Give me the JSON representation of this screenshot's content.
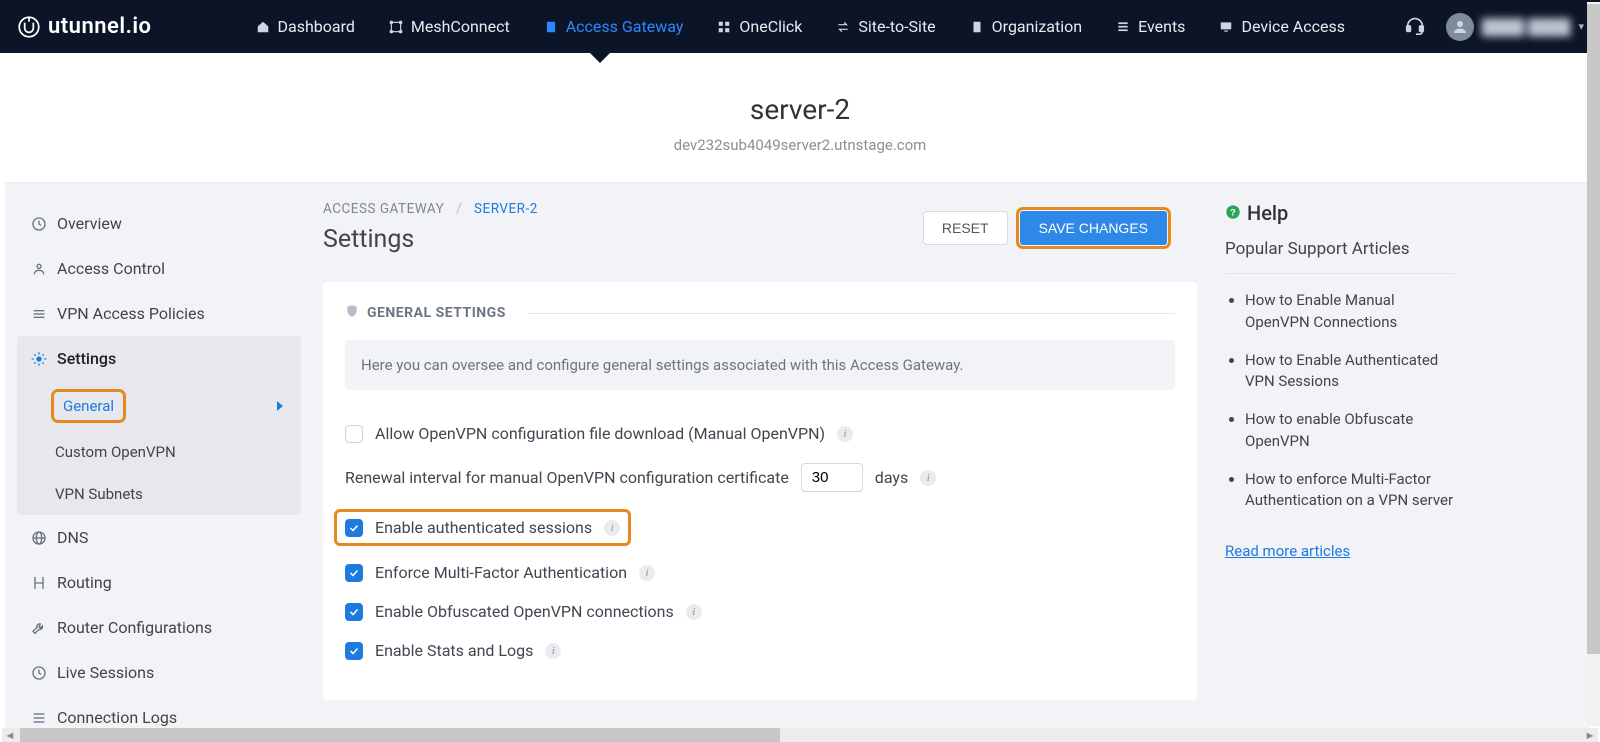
{
  "brand": {
    "name": "utunnel.io"
  },
  "nav": {
    "items": [
      {
        "label": "Dashboard"
      },
      {
        "label": "MeshConnect"
      },
      {
        "label": "Access Gateway",
        "active": true
      },
      {
        "label": "OneClick"
      },
      {
        "label": "Site-to-Site"
      },
      {
        "label": "Organization"
      },
      {
        "label": "Events"
      },
      {
        "label": "Device Access"
      }
    ]
  },
  "header": {
    "title": "server-2",
    "subtitle": "dev232sub4049server2.utnstage.com"
  },
  "breadcrumb": {
    "root": "ACCESS GATEWAY",
    "sep": "/",
    "current": "SERVER-2"
  },
  "page": {
    "heading": "Settings",
    "reset": "RESET",
    "save": "SAVE CHANGES"
  },
  "sidebar": {
    "items": [
      {
        "label": "Overview"
      },
      {
        "label": "Access Control"
      },
      {
        "label": "VPN Access Policies"
      },
      {
        "label": "Settings",
        "children": [
          {
            "label": "General",
            "active": true
          },
          {
            "label": "Custom OpenVPN"
          },
          {
            "label": "VPN Subnets"
          }
        ]
      },
      {
        "label": "DNS"
      },
      {
        "label": "Routing"
      },
      {
        "label": "Router Configurations"
      },
      {
        "label": "Live Sessions"
      },
      {
        "label": "Connection Logs"
      }
    ]
  },
  "settings": {
    "section_title": "GENERAL SETTINGS",
    "info": "Here you can oversee and configure general settings associated with this Access Gateway.",
    "allow_ovpn_label": "Allow OpenVPN configuration file download (Manual OpenVPN)",
    "allow_ovpn_checked": false,
    "renewal_label_pre": "Renewal interval for manual OpenVPN configuration certificate",
    "renewal_value": "30",
    "renewal_label_post": "days",
    "auth_sessions_label": "Enable authenticated sessions",
    "auth_sessions_checked": true,
    "mfa_label": "Enforce Multi-Factor Authentication",
    "mfa_checked": true,
    "obf_label": "Enable Obfuscated OpenVPN connections",
    "obf_checked": true,
    "stats_label": "Enable Stats and Logs",
    "stats_checked": true
  },
  "help": {
    "title": "Help",
    "subtitle": "Popular Support Articles",
    "articles": [
      "How to Enable Manual OpenVPN Connections",
      "How to Enable Authenticated VPN Sessions",
      "How to enable Obfuscate OpenVPN",
      "How to enforce Multi-Factor Authentication on a VPN server"
    ],
    "read_more": "Read more articles"
  },
  "colors": {
    "accent": "#1f7ae0",
    "highlight": "#e68a1f"
  }
}
